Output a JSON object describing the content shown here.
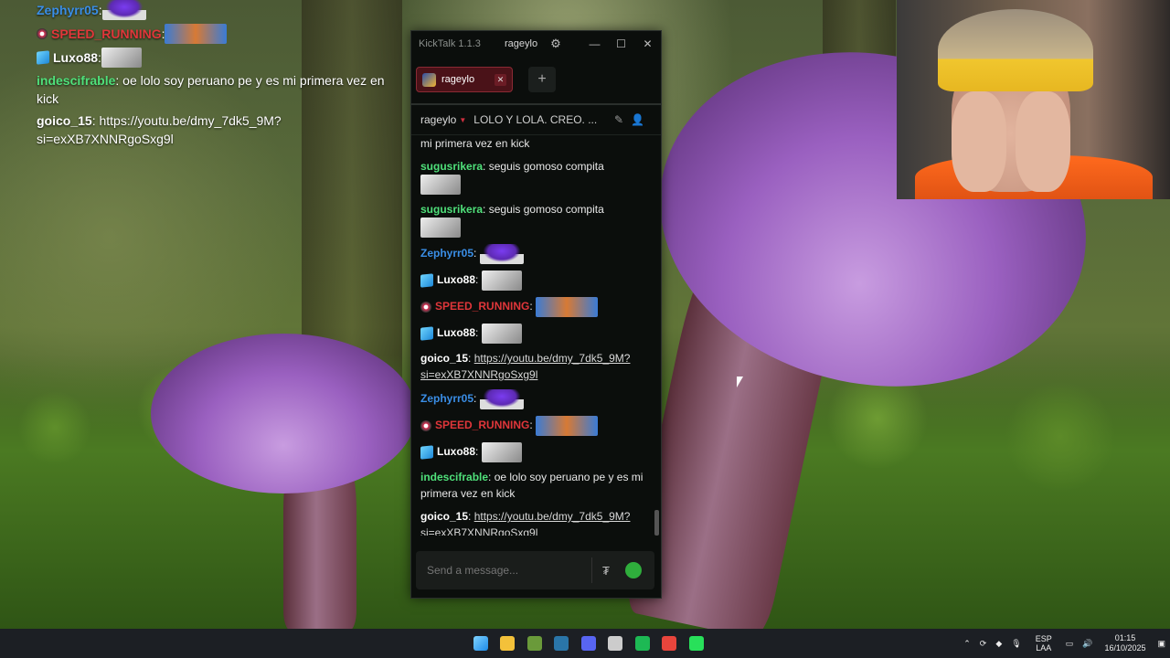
{
  "overlay_chat": [
    {
      "user": "Zephyrr05",
      "color": "#3a8ee6",
      "emote": "purple"
    },
    {
      "user": "SPEED_RUNNING",
      "color": "#e0363a",
      "badge": "circle",
      "emote": "wide"
    },
    {
      "user": "Luxo88",
      "color": "#ffffff",
      "badge": "cube",
      "emote": "gray"
    },
    {
      "user": "indescifrable",
      "color": "#4fe07a",
      "text": "oe lolo soy peruano pe y es mi primera vez en kick"
    },
    {
      "user": "goico_15",
      "color": "#ffffff",
      "text": "https://youtu.be/dmy_7dk5_9M?si=exXB7XNNRgoSxg9l"
    }
  ],
  "kicktalk": {
    "app_title": "KickTalk 1.1.3",
    "user": "rageylo",
    "tab_label": "rageylo",
    "add_tab": "+",
    "channel": "rageylo",
    "stream_title": "LOLO Y LOLA. CREO. ...",
    "input_placeholder": "Send a message...",
    "messages": [
      {
        "user": "",
        "text": "mi primera vez en kick"
      },
      {
        "user": "sugusrikera",
        "color": "#4fe07a",
        "text": "seguis gomoso compita",
        "emote": "gray"
      },
      {
        "user": "sugusrikera",
        "color": "#4fe07a",
        "text": "seguis gomoso compita",
        "emote": "gray"
      },
      {
        "user": "Zephyrr05",
        "color": "#3a8ee6",
        "emote": "purple"
      },
      {
        "user": "Luxo88",
        "color": "#ffffff",
        "badge": "cube",
        "emote": "gray"
      },
      {
        "user": "SPEED_RUNNING",
        "color": "#e0363a",
        "badge": "circle",
        "emote": "wide"
      },
      {
        "user": "Luxo88",
        "color": "#ffffff",
        "badge": "cube",
        "emote": "gray"
      },
      {
        "user": "goico_15",
        "color": "#ffffff",
        "link": "https://youtu.be/dmy_7dk5_9M?si=exXB7XNNRgoSxg9l"
      },
      {
        "user": "Zephyrr05",
        "color": "#3a8ee6",
        "emote": "purple"
      },
      {
        "user": "SPEED_RUNNING",
        "color": "#e0363a",
        "badge": "circle",
        "emote": "wide"
      },
      {
        "user": "Luxo88",
        "color": "#ffffff",
        "badge": "cube",
        "emote": "gray"
      },
      {
        "user": "indescifrable",
        "color": "#4fe07a",
        "text": "oe lolo soy peruano pe y es mi primera vez en kick"
      },
      {
        "user": "goico_15",
        "color": "#ffffff",
        "link": "https://youtu.be/dmy_7dk5_9M?si=exXB7XNNRgoSxg9l"
      }
    ]
  },
  "taskbar": {
    "apps": [
      {
        "name": "windows-start-icon",
        "color": "#3ea6ff"
      },
      {
        "name": "file-explorer-icon",
        "color": "#f3c13a"
      },
      {
        "name": "minecraft-icon",
        "color": "#6a9a3a"
      },
      {
        "name": "steam-icon",
        "color": "#2a75a8"
      },
      {
        "name": "discord-icon",
        "color": "#5865f2",
        "badge": "9+"
      },
      {
        "name": "github-icon",
        "color": "#cccccc"
      },
      {
        "name": "spotify-icon",
        "color": "#1db954"
      },
      {
        "name": "chrome-icon",
        "color": "#e8453c"
      },
      {
        "name": "kicktalk-icon",
        "color": "#28e05a"
      }
    ],
    "lang": "ESP",
    "lang_sub": "LAA",
    "time": "01:15",
    "date": "16/10/2025"
  }
}
